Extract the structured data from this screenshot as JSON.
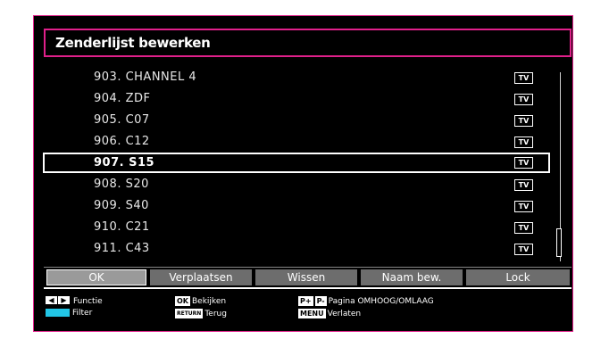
{
  "title": "Zenderlijst bewerken",
  "channels": [
    {
      "label": "903. CHANNEL 4",
      "type": "TV"
    },
    {
      "label": "904. ZDF",
      "type": "TV"
    },
    {
      "label": "905. C07",
      "type": "TV"
    },
    {
      "label": "906. C12",
      "type": "TV"
    },
    {
      "label": "907. S15",
      "type": "TV"
    },
    {
      "label": "908. S20",
      "type": "TV"
    },
    {
      "label": "909. S40",
      "type": "TV"
    },
    {
      "label": "910. C21",
      "type": "TV"
    },
    {
      "label": "911. C43",
      "type": "TV"
    }
  ],
  "selected_channel": "907. S15",
  "buttons": {
    "ok": "OK",
    "move": "Verplaatsen",
    "delete": "Wissen",
    "rename": "Naam bew.",
    "lock": "Lock"
  },
  "legend": {
    "function": "Functie",
    "filter": "Filter",
    "ok_key": "OK",
    "view": "Bekijken",
    "return_key": "RETURN",
    "back": "Terug",
    "page_up_key": "P+",
    "page_down_key": "P-",
    "page": "Pagina OMHOOG/OMLAAG",
    "menu_key": "MENU",
    "exit": "Verlaten"
  },
  "colors": {
    "frame": "#e0208a",
    "filter_key": "#22c6e6",
    "button": "#6d6d6d"
  }
}
